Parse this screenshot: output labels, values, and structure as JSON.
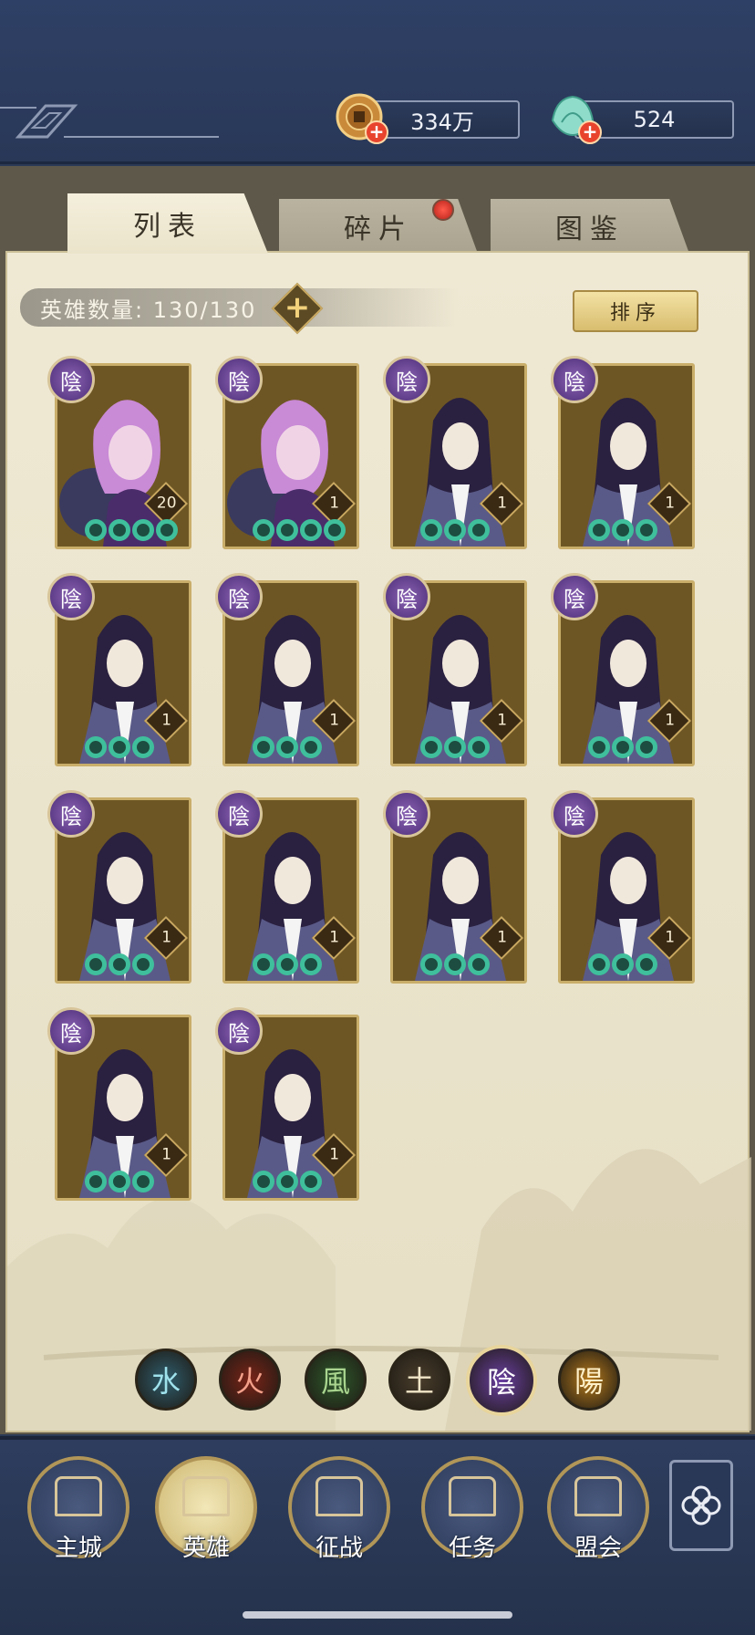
{
  "resources": {
    "coins": "334万",
    "gems": "524"
  },
  "tabs": [
    {
      "label": "列表",
      "active": true
    },
    {
      "label": "碎片",
      "active": false,
      "badge": true
    },
    {
      "label": "图鉴",
      "active": false
    }
  ],
  "hero_count": {
    "label": "英雄数量: 130/130"
  },
  "sort_label": "排序",
  "heroes": [
    {
      "element": "陰",
      "level": "20",
      "stars": 4,
      "portrait": "pink-hair-hero"
    },
    {
      "element": "陰",
      "level": "1",
      "stars": 4,
      "portrait": "pink-hair-hero"
    },
    {
      "element": "陰",
      "level": "1",
      "stars": 3,
      "portrait": "long-black-hair-hero"
    },
    {
      "element": "陰",
      "level": "1",
      "stars": 3,
      "portrait": "long-black-hair-hero"
    },
    {
      "element": "陰",
      "level": "1",
      "stars": 3,
      "portrait": "long-black-hair-hero"
    },
    {
      "element": "陰",
      "level": "1",
      "stars": 3,
      "portrait": "long-black-hair-hero"
    },
    {
      "element": "陰",
      "level": "1",
      "stars": 3,
      "portrait": "long-black-hair-hero"
    },
    {
      "element": "陰",
      "level": "1",
      "stars": 3,
      "portrait": "long-black-hair-hero"
    },
    {
      "element": "陰",
      "level": "1",
      "stars": 3,
      "portrait": "long-black-hair-hero"
    },
    {
      "element": "陰",
      "level": "1",
      "stars": 3,
      "portrait": "long-black-hair-hero"
    },
    {
      "element": "陰",
      "level": "1",
      "stars": 3,
      "portrait": "long-black-hair-hero"
    },
    {
      "element": "陰",
      "level": "1",
      "stars": 3,
      "portrait": "long-black-hair-hero"
    },
    {
      "element": "陰",
      "level": "1",
      "stars": 3,
      "portrait": "long-black-hair-hero"
    },
    {
      "element": "陰",
      "level": "1",
      "stars": 3,
      "portrait": "long-black-hair-hero"
    }
  ],
  "elements": [
    {
      "glyph": "水",
      "name": "water",
      "color": "#2f5e6e",
      "text": "#9fe2ec",
      "active": false
    },
    {
      "glyph": "火",
      "name": "fire",
      "color": "#7a2418",
      "text": "#f3a08a",
      "active": false
    },
    {
      "glyph": "風",
      "name": "wind",
      "color": "#2f5a2c",
      "text": "#a9d58f",
      "active": false
    },
    {
      "glyph": "土",
      "name": "earth",
      "color": "#4a3e2c",
      "text": "#f1e6c8",
      "active": false
    },
    {
      "glyph": "陰",
      "name": "yin",
      "color": "#6a3fa0",
      "text": "#ffffff",
      "active": true
    },
    {
      "glyph": "陽",
      "name": "yang",
      "color": "#b57a1c",
      "text": "#fff0c8",
      "active": false
    }
  ],
  "nav": [
    {
      "label": "主城",
      "icon": "city-icon",
      "active": false
    },
    {
      "label": "英雄",
      "icon": "hero-icon",
      "active": true
    },
    {
      "label": "征战",
      "icon": "battle-icon",
      "active": false
    },
    {
      "label": "任务",
      "icon": "quest-icon",
      "active": false
    },
    {
      "label": "盟会",
      "icon": "guild-icon",
      "active": false
    }
  ],
  "colors": {
    "accent_gold": "#c9ae6a",
    "frame_navy": "#2b3a55",
    "parchment": "#efe9d4",
    "yin_purple": "#6a3fa0",
    "jade_green": "#3fbf9c"
  }
}
